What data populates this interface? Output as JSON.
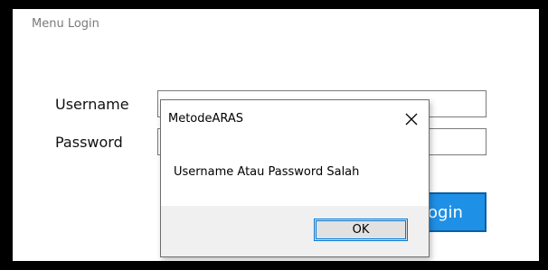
{
  "window": {
    "title": "Menu Login"
  },
  "form": {
    "username_label": "Username",
    "password_label": "Password",
    "username_value": "",
    "password_value": "",
    "login_button_partial": "ogin"
  },
  "dialog": {
    "title": "MetodeARAS",
    "message": "Username Atau Password Salah",
    "ok_label": "OK",
    "close_icon": "close-icon"
  },
  "colors": {
    "login_button": "#1e90e6",
    "ok_focus_border": "#0078d7",
    "dialog_footer": "#f0f0f0"
  }
}
